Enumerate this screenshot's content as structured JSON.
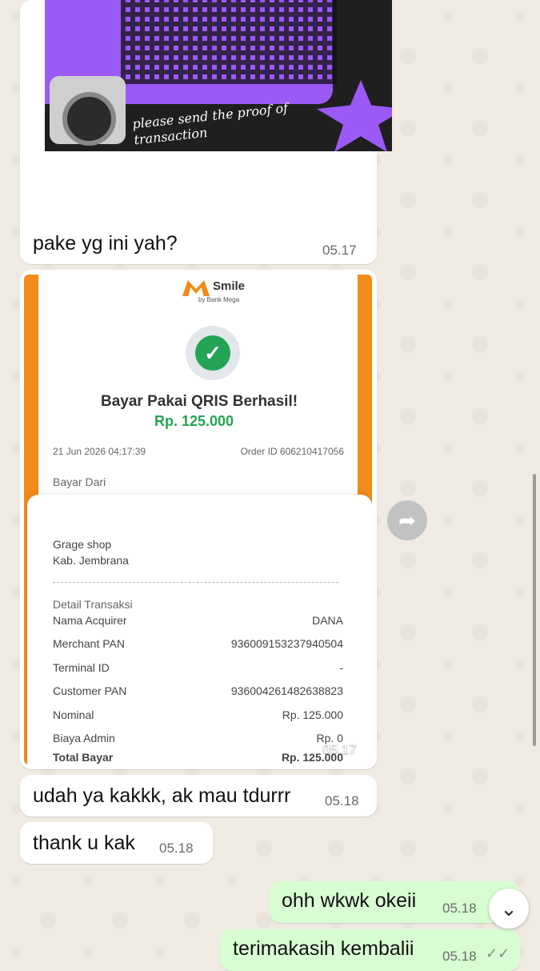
{
  "messages": [
    {
      "text": "pake yg ini yah?",
      "time": "05.17"
    },
    {
      "time": "05.17"
    },
    {
      "text": "udah ya kakkk, ak mau tdurrr",
      "time": "05.18"
    },
    {
      "text": "thank u kak",
      "time": "05.18"
    },
    {
      "text": "ohh wkwk okeii",
      "time": "05.18"
    },
    {
      "text": "terimakasih kembalii",
      "time": "05.18"
    }
  ],
  "image_caption": "please send the proof of transaction",
  "receipt": {
    "brand": "Smile",
    "brand_sub": "by Bank Mega",
    "title": "Bayar Pakai QRIS Berhasil!",
    "amount": "Rp. 125.000",
    "date": "21 Jun 2026 04:17:39",
    "order_id": "Order ID 606210417056",
    "from_label": "Bayar Dari",
    "merchant_name": "Grage shop",
    "merchant_location": "Kab. Jembrana",
    "detail_title": "Detail Transaksi",
    "rows": [
      {
        "label": "Nama Acquirer",
        "value": "DANA"
      },
      {
        "label": "Merchant PAN",
        "value": "936009153237940504"
      },
      {
        "label": "Terminal ID",
        "value": "-"
      },
      {
        "label": "Customer PAN",
        "value": "936004261482638823"
      },
      {
        "label": "Nominal",
        "value": "Rp. 125.000"
      },
      {
        "label": "Biaya Admin",
        "value": "Rp. 0"
      },
      {
        "label": "Total Bayar",
        "value": "Rp. 125.000"
      }
    ]
  },
  "icons": {
    "forward": "forward-icon",
    "scroll_down": "chevron-down-icon",
    "read": "double-check-icon",
    "check": "checkmark-icon"
  },
  "colors": {
    "chat_bg": "#efeae2",
    "outgoing_bubble": "#d9fdd3",
    "incoming_bubble": "#ffffff",
    "success_green": "#23a455",
    "brand_orange": "#f28c1a",
    "accent_purple": "#9b59f6"
  }
}
